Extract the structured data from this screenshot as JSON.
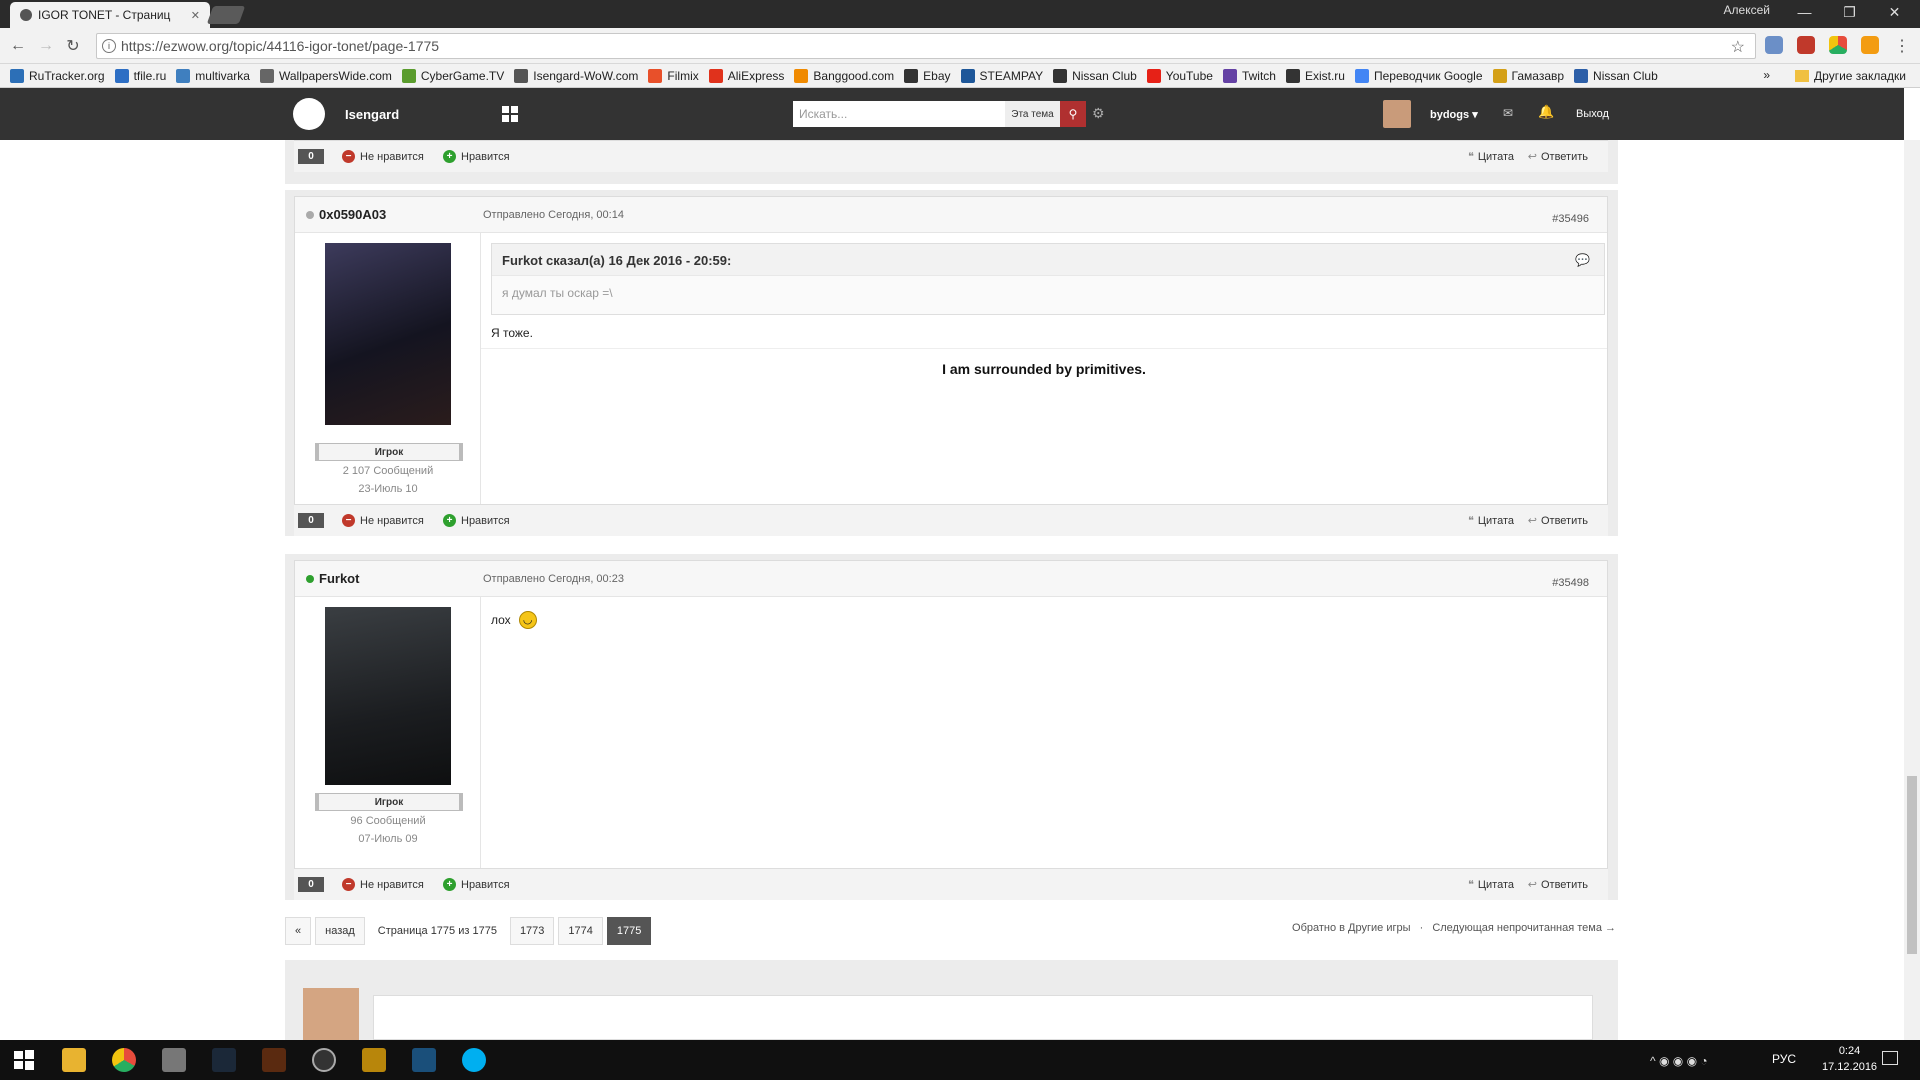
{
  "browser": {
    "tab_title": "IGOR TONET - Страниц",
    "user_name": "Алексей",
    "url": "https://ezwow.org/topic/44116-igor-tonet/page-1775",
    "window_controls": [
      "—",
      "❐",
      "✕"
    ]
  },
  "bookmarks": {
    "items": [
      {
        "label": "RuTracker.org",
        "color": "#2c6fb7"
      },
      {
        "label": "tfile.ru",
        "color": "#2d6ec4"
      },
      {
        "label": "multivarka",
        "color": "#3f7fbf"
      },
      {
        "label": "WallpapersWide.com",
        "color": "#666666"
      },
      {
        "label": "CyberGame.TV",
        "color": "#5a9c2d"
      },
      {
        "label": "Isengard-WoW.com",
        "color": "#555555"
      },
      {
        "label": "Filmix",
        "color": "#e8502a"
      },
      {
        "label": "AliExpress",
        "color": "#e0321c"
      },
      {
        "label": "Banggood.com",
        "color": "#f08a00"
      },
      {
        "label": "Ebay",
        "color": "#333333"
      },
      {
        "label": "STEAMPAY",
        "color": "#1e5799"
      },
      {
        "label": "Nissan Club",
        "color": "#333333"
      },
      {
        "label": "YouTube",
        "color": "#e62117"
      },
      {
        "label": "Twitch",
        "color": "#6441a4"
      },
      {
        "label": "Exist.ru",
        "color": "#333333"
      },
      {
        "label": "Переводчик Google",
        "color": "#4285f4"
      },
      {
        "label": "Гамазавр",
        "color": "#d4a017"
      },
      {
        "label": "Nissan Club",
        "color": "#2d5fa8"
      }
    ],
    "overflow": "»",
    "other": "Другие закладки"
  },
  "site": {
    "name": "Isengard",
    "search_placeholder": "Искать...",
    "search_scope": "Эта тема",
    "username": "bydogs",
    "logout": "Выход"
  },
  "top_bar": {
    "rep": "0",
    "dislike": "Не нравится",
    "like": "Нравится",
    "quote": "Цитата",
    "reply": "Ответить"
  },
  "posts": [
    {
      "author": "0x0590A03",
      "status_color": "#aaaaaa",
      "date": "Отправлено Сегодня, 00:14",
      "number": "#35496",
      "rank": "Игрок",
      "messages": "2 107 Сообщений",
      "joined": "23-Июль 10",
      "quote_header": "Furkot сказал(а) 16 Дек 2016 - 20:59:",
      "quote_text": "я думал ты оскар =\\",
      "text": "Я тоже.",
      "signature": "I am surrounded by primitives.",
      "rep": "0",
      "dislike": "Не нравится",
      "like": "Нравится",
      "quote": "Цитата",
      "reply": "Ответить"
    },
    {
      "author": "Furkot",
      "status_color": "#2ea02e",
      "date": "Отправлено Сегодня, 00:23",
      "number": "#35498",
      "rank": "Игрок",
      "messages": "96 Сообщений",
      "joined": "07-Июль 09",
      "text": "лох",
      "rep": "0",
      "dislike": "Не нравится",
      "like": "Нравится",
      "quote": "Цитата",
      "reply": "Ответить"
    }
  ],
  "pagination": {
    "first": "«",
    "prev": "назад",
    "info": "Страница 1775 из 1775",
    "pages": [
      "1773",
      "1774",
      "1775"
    ],
    "current": "1775",
    "back_link": "Обратно в Другие игры",
    "separator": "·",
    "next_unread": "Следующая непрочитанная тема →"
  },
  "taskbar": {
    "lang": "РУС",
    "time": "0:24",
    "date": "17.12.2016"
  },
  "colors": {
    "site_header": "#333333",
    "accent_red": "#b03030",
    "online": "#2ea02e"
  }
}
